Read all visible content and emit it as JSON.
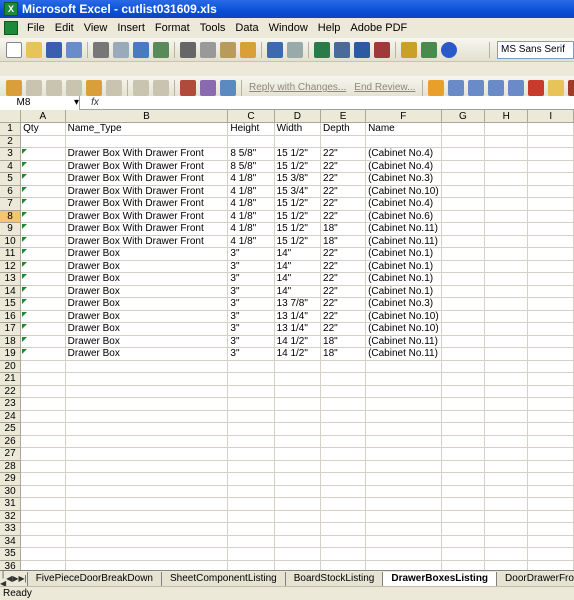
{
  "window": {
    "title": "Microsoft Excel - cutlist031609.xls",
    "app_icon": "excel-icon"
  },
  "menu": [
    "File",
    "Edit",
    "View",
    "Insert",
    "Format",
    "Tools",
    "Data",
    "Window",
    "Help",
    "Adobe PDF"
  ],
  "toolbar": {
    "font_name": "MS Sans Serif"
  },
  "review_toolbar": {
    "reply_label": "Reply with Changes...",
    "end_review_label": "End Review..."
  },
  "formula_bar": {
    "name_box": "M8",
    "fx_label": "fx",
    "formula": ""
  },
  "columns": [
    "A",
    "B",
    "C",
    "D",
    "E",
    "F",
    "G",
    "H",
    "I"
  ],
  "rows": [
    [
      "Qty",
      "Name_Type",
      "Height",
      "Width",
      "Depth",
      "Name",
      "",
      "",
      ""
    ],
    [
      "",
      "",
      "",
      "",
      "",
      "",
      "",
      "",
      ""
    ],
    [
      "",
      "Drawer Box With Drawer Front",
      "8 5/8\"",
      "15 1/2\"",
      "22\"",
      "(Cabinet No.4)",
      "",
      "",
      ""
    ],
    [
      "",
      "Drawer Box With Drawer Front",
      "8 5/8\"",
      "15 1/2\"",
      "22\"",
      "(Cabinet No.4)",
      "",
      "",
      ""
    ],
    [
      "",
      "Drawer Box With Drawer Front",
      "4 1/8\"",
      "15 3/8\"",
      "22\"",
      "(Cabinet No.3)",
      "",
      "",
      ""
    ],
    [
      "",
      "Drawer Box With Drawer Front",
      "4 1/8\"",
      "15 3/4\"",
      "22\"",
      "(Cabinet No.10)",
      "",
      "",
      ""
    ],
    [
      "",
      "Drawer Box With Drawer Front",
      "4 1/8\"",
      "15 1/2\"",
      "22\"",
      "(Cabinet No.4)",
      "",
      "",
      ""
    ],
    [
      "",
      "Drawer Box With Drawer Front",
      "4 1/8\"",
      "15 1/2\"",
      "22\"",
      "(Cabinet No.6)",
      "",
      "",
      ""
    ],
    [
      "",
      "Drawer Box With Drawer Front",
      "4 1/8\"",
      "15 1/2\"",
      "18\"",
      "(Cabinet No.11)",
      "",
      "",
      ""
    ],
    [
      "",
      "Drawer Box With Drawer Front",
      "4 1/8\"",
      "15 1/2\"",
      "18\"",
      "(Cabinet No.11)",
      "",
      "",
      ""
    ],
    [
      "",
      "Drawer Box",
      "3\"",
      "14\"",
      "22\"",
      "(Cabinet No.1)",
      "",
      "",
      ""
    ],
    [
      "",
      "Drawer Box",
      "3\"",
      "14\"",
      "22\"",
      "(Cabinet No.1)",
      "",
      "",
      ""
    ],
    [
      "",
      "Drawer Box",
      "3\"",
      "14\"",
      "22\"",
      "(Cabinet No.1)",
      "",
      "",
      ""
    ],
    [
      "",
      "Drawer Box",
      "3\"",
      "14\"",
      "22\"",
      "(Cabinet No.1)",
      "",
      "",
      ""
    ],
    [
      "",
      "Drawer Box",
      "3\"",
      "13 7/8\"",
      "22\"",
      "(Cabinet No.3)",
      "",
      "",
      ""
    ],
    [
      "",
      "Drawer Box",
      "3\"",
      "13 1/4\"",
      "22\"",
      "(Cabinet No.10)",
      "",
      "",
      ""
    ],
    [
      "",
      "Drawer Box",
      "3\"",
      "13 1/4\"",
      "22\"",
      "(Cabinet No.10)",
      "",
      "",
      ""
    ],
    [
      "",
      "Drawer Box",
      "3\"",
      "14 1/2\"",
      "18\"",
      "(Cabinet No.11)",
      "",
      "",
      ""
    ],
    [
      "",
      "Drawer Box",
      "3\"",
      "14 1/2\"",
      "18\"",
      "(Cabinet No.11)",
      "",
      "",
      ""
    ]
  ],
  "total_rows": 36,
  "selected_row": 8,
  "sheet_tabs": [
    "FivePieceDoorBreakDown",
    "SheetComponentListing",
    "BoardStockListing",
    "DrawerBoxesListing",
    "DoorDrawerFror"
  ],
  "active_sheet": "DrawerBoxesListing",
  "status": "Ready"
}
